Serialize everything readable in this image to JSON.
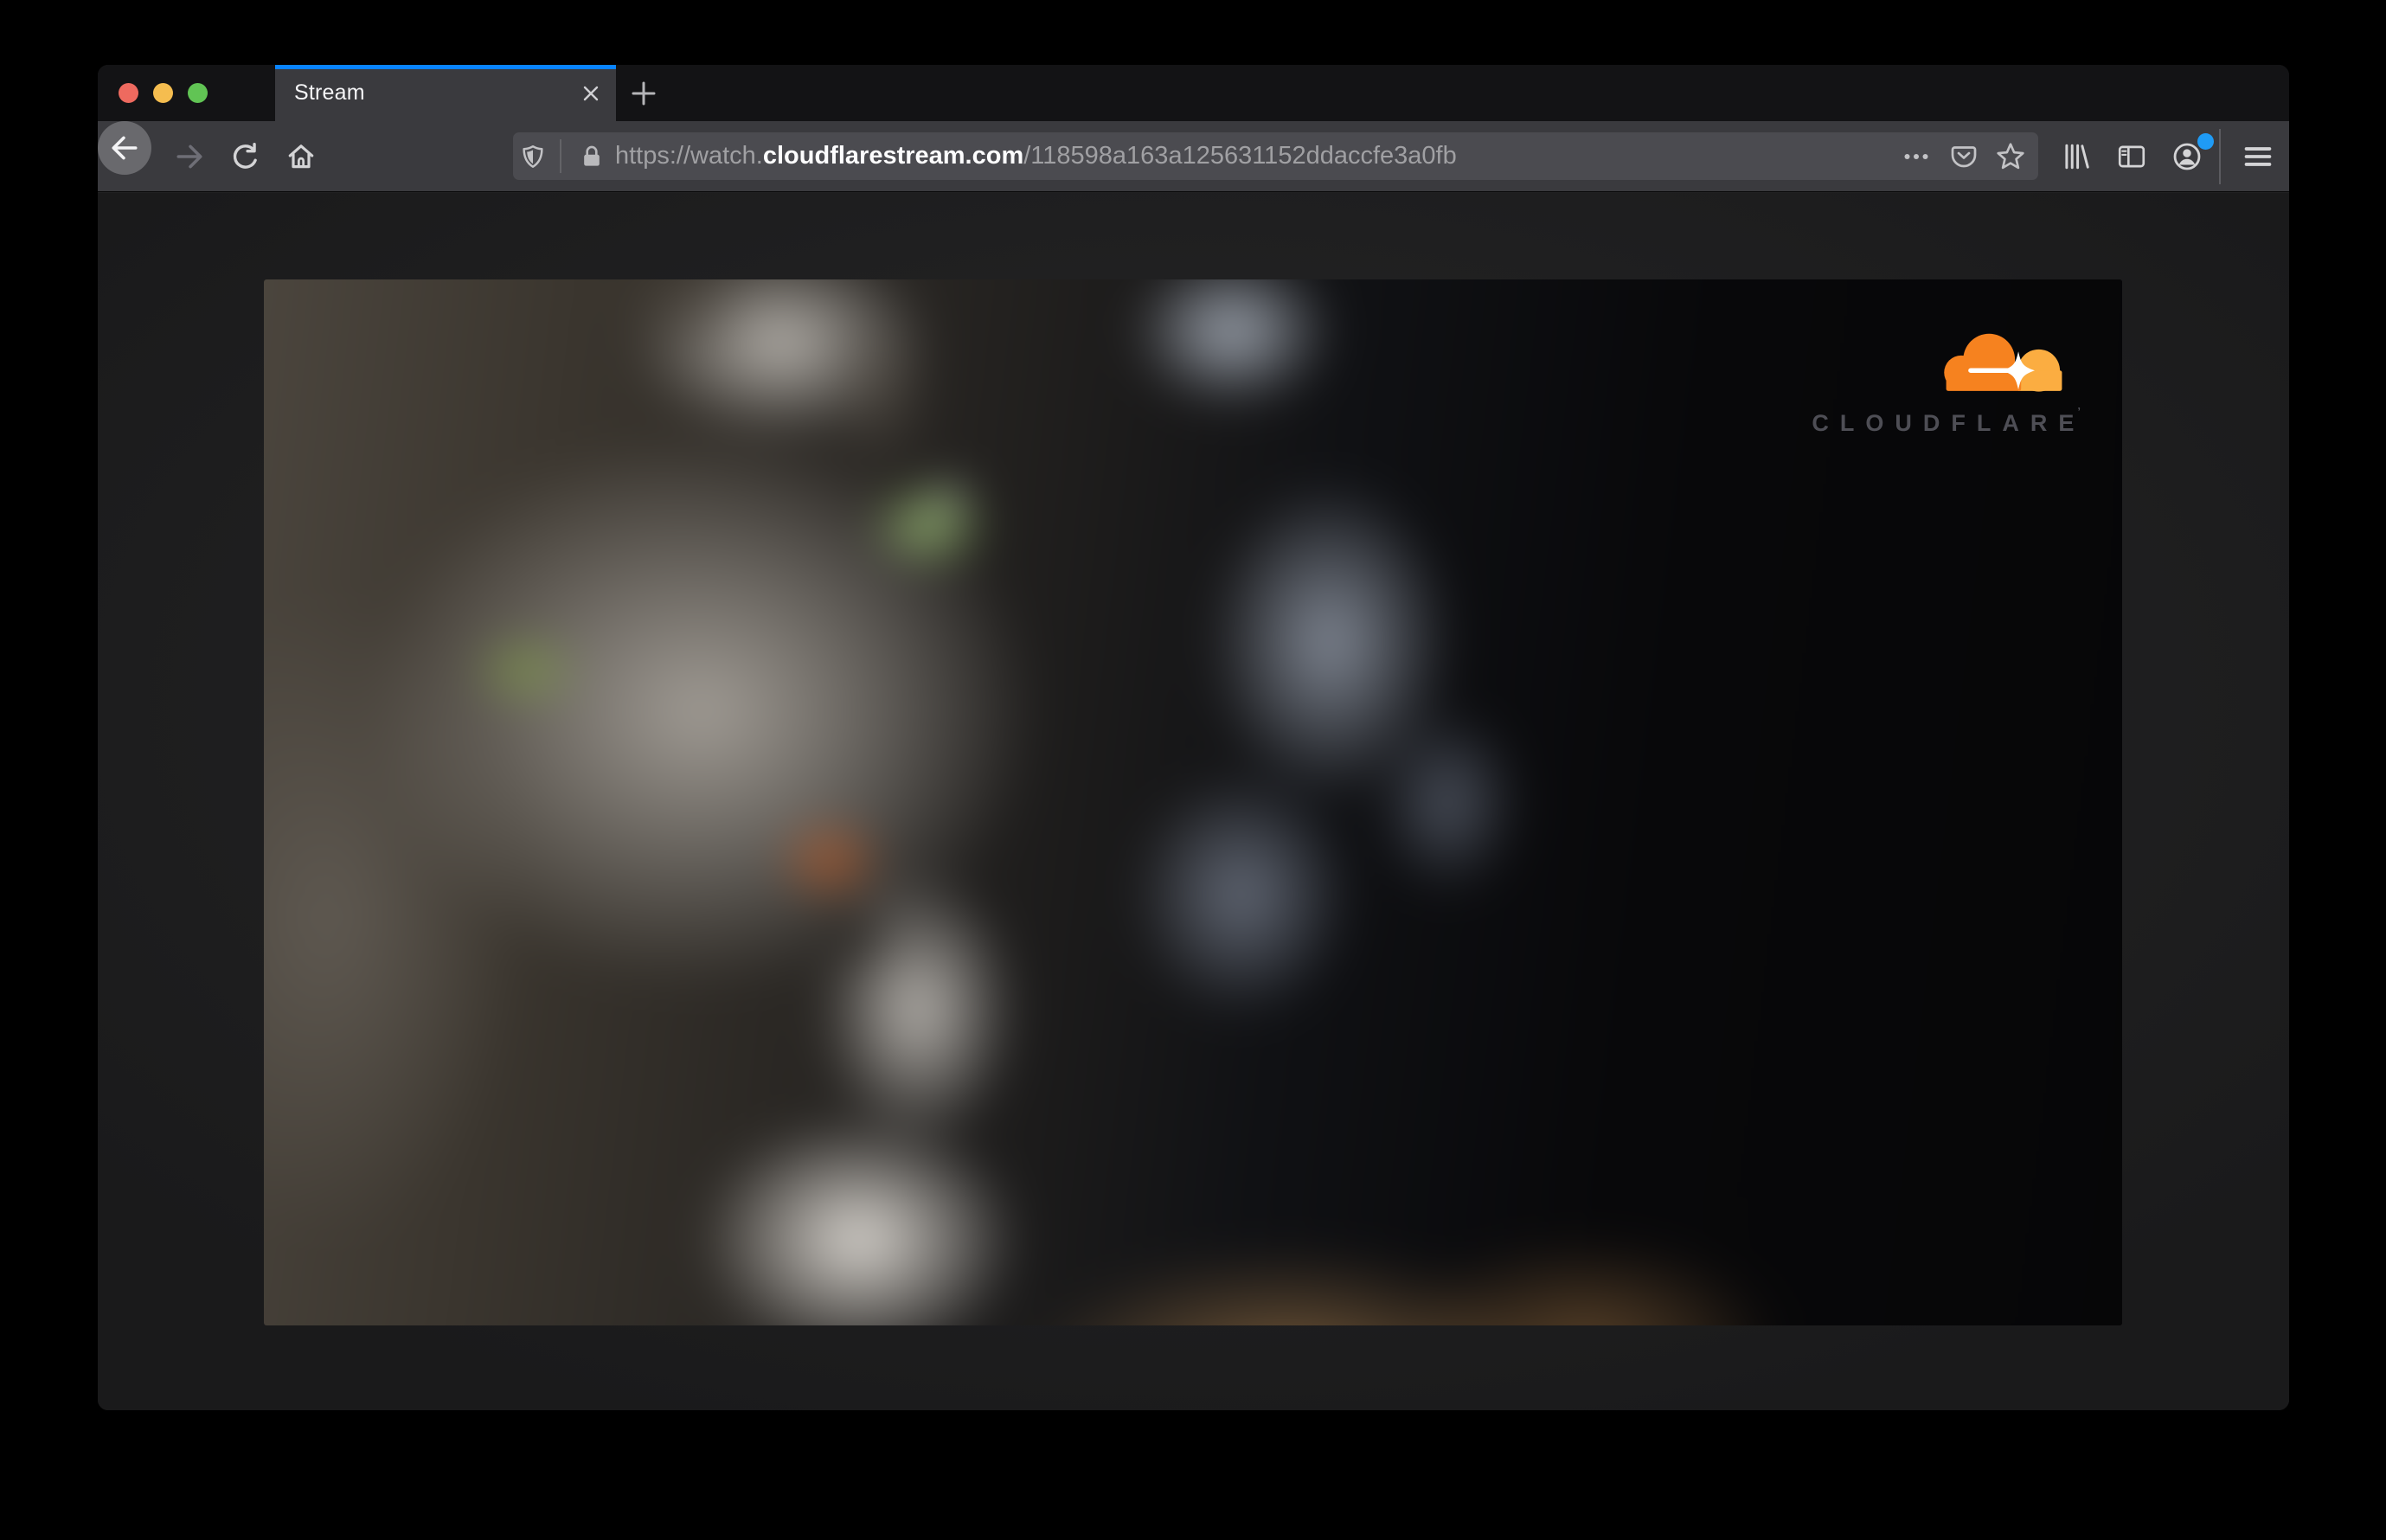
{
  "window": {
    "controls": [
      {
        "name": "close",
        "color": "#ee6a5f"
      },
      {
        "name": "minimize",
        "color": "#f5bd4f"
      },
      {
        "name": "zoom",
        "color": "#61c454"
      }
    ]
  },
  "tab_bar": {
    "tab": {
      "title": "Stream"
    },
    "accent_color": "#0a84ff",
    "icons": [
      "close-icon",
      "new-tab-plus-icon"
    ]
  },
  "toolbar": {
    "navigation_icons": [
      "back-icon",
      "forward-icon",
      "reload-icon",
      "home-icon"
    ],
    "url_bar": {
      "url_prefix": "https://watch.",
      "url_host": "cloudflarestream.com",
      "url_path": "/118598a163a125631152ddaccfe3a0fb",
      "icons": [
        "tracking-protection-shield-icon",
        "lock-icon",
        "page-actions-ellipsis-icon",
        "pocket-icon",
        "bookmark-star-icon"
      ]
    },
    "right_icons": [
      "library-icon",
      "sidebar-icon",
      "account-icon",
      "menu-icon"
    ],
    "account_badge_color": "#1f9bf5"
  },
  "page": {
    "video_player": {
      "watermark_text": "CLOUDFLARE",
      "trademark_mark": "’",
      "watermark_orange": "#f6821f",
      "watermark_light_orange": "#fbad41",
      "watermark_text_color": "#4e4e55"
    }
  }
}
